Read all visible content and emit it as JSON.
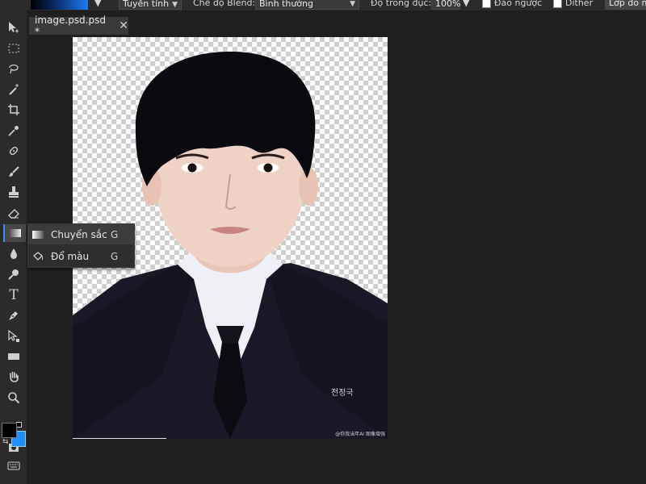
{
  "options_bar": {
    "gradient_type": "Tuyến tính",
    "blend_label": "Chế độ Blend:",
    "blend_value": "Bình thường",
    "opacity_label": "Độ trong đục:",
    "opacity_value": "100%",
    "reverse_label": "Đảo ngược",
    "dither_label": "Dither",
    "layer_mask_label": "Lớp đo m"
  },
  "document_tab": {
    "title": "image.psd.psd *"
  },
  "flyout": {
    "items": [
      {
        "label": "Chuyển sắc",
        "shortcut": "G",
        "icon": "gradient-icon"
      },
      {
        "label": "Đổ màu",
        "shortcut": "G",
        "icon": "paint-bucket-icon"
      }
    ]
  },
  "canvas": {
    "watermark_text": "@你我当年AI 图像增强"
  },
  "colors": {
    "foreground": "#000000",
    "background": "#1e90ff",
    "accent": "#3b8cff"
  },
  "tools": [
    "move-icon",
    "marquee-icon",
    "lasso-icon",
    "magic-wand-icon",
    "crop-icon",
    "eyedropper-icon",
    "healing-icon",
    "brush-icon",
    "stamp-icon",
    "eraser-icon",
    "gradient-icon",
    "blur-icon",
    "dodge-icon",
    "text-icon",
    "pen-icon",
    "path-select-icon",
    "shape-icon",
    "hand-icon",
    "zoom-icon"
  ]
}
